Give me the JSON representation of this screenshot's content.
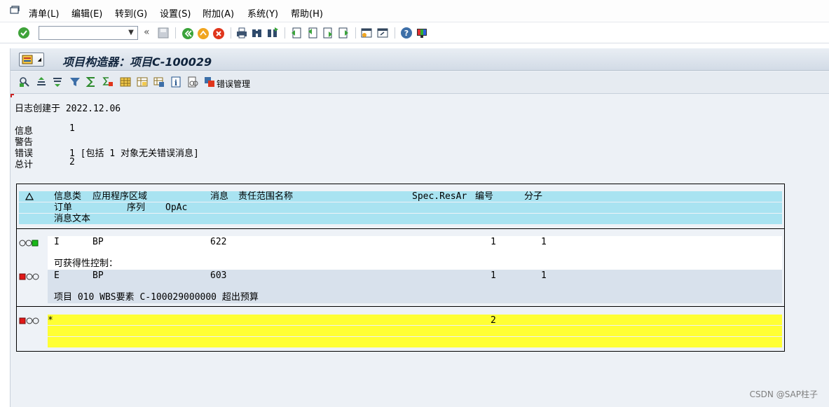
{
  "menu": {
    "items": [
      "清单(L)",
      "编辑(E)",
      "转到(G)",
      "设置(S)",
      "附加(A)",
      "系统(Y)",
      "帮助(H)"
    ]
  },
  "toolbar": {
    "command_value": "",
    "icons": [
      "enter-check-icon",
      "back-icon",
      "save-icon",
      "back-green-icon",
      "exit-icon",
      "cancel-icon",
      "print-icon",
      "find-icon",
      "find-next-icon",
      "first-page-icon",
      "prev-page-icon",
      "next-page-icon",
      "last-page-icon",
      "new-session-icon",
      "shortcut-icon",
      "help-icon",
      "customize-layout-icon"
    ]
  },
  "title": "项目构造器：项目C-100029",
  "app_toolbar": {
    "error_mgmt_label": "错误管理"
  },
  "log": {
    "created_label": "日志创建于",
    "created_date": "2022.12.06",
    "info_label": "信息",
    "info_count": "1",
    "warning_label": "警告",
    "error_label": "错误",
    "error_count": "1 [包括 1 对象无关错误消息]",
    "total_label": "总计",
    "total_count": "2"
  },
  "grid": {
    "header1": [
      "信息类",
      "应用程序区域",
      "消息",
      "责任范围名称",
      "Spec.ResAr",
      "编号",
      "分子"
    ],
    "header2": [
      "订单",
      "序列",
      "OpAc"
    ],
    "header3": [
      "消息文本"
    ],
    "rows": [
      {
        "type": "I",
        "area": "BP",
        "msg": "622",
        "num": "1",
        "count": "1",
        "text": "可获得性控制："
      },
      {
        "type": "E",
        "area": "BP",
        "msg": "603",
        "num": "1",
        "count": "1",
        "text": "项目 010 WBS要素 C-100029000000 超出预算"
      }
    ],
    "total": {
      "type": "*",
      "num": "2"
    }
  },
  "watermark": "CSDN @SAP柱子",
  "colors": {
    "header_bg": "#a9e3f1",
    "total_bg": "#ffff33",
    "light_green": "#18b818",
    "light_red": "#e01818"
  }
}
